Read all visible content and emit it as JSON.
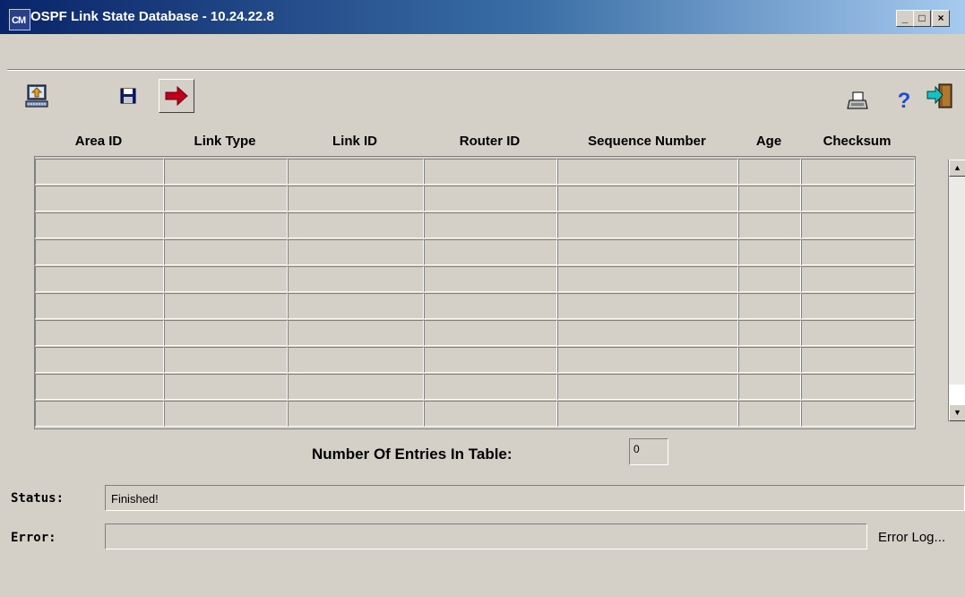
{
  "window": {
    "title": "OSPF Link State Database - 10.24.22.8",
    "app_icon_text": "CM",
    "minimize_label": "_",
    "maximize_label": "□",
    "close_label": "×"
  },
  "toolbar": {
    "left_icons": [
      "load-icon",
      "save-icon",
      "go-arrow-icon"
    ],
    "right_icons": [
      "print-icon",
      "help-icon",
      "exit-icon"
    ],
    "help_glyph": "?"
  },
  "table": {
    "columns": [
      "Area ID",
      "Link Type",
      "Link ID",
      "Router ID",
      "Sequence Number",
      "Age",
      "Checksum"
    ],
    "rows": []
  },
  "footer": {
    "entries_label": "Number Of Entries In Table:",
    "entries_value": "0",
    "status_label": "Status:",
    "status_value": "Finished!",
    "error_label": "Error:",
    "error_value": "",
    "error_log_label": "Error Log..."
  },
  "colors": {
    "background": "#d4d0c8",
    "titlebar_start": "#0a246a",
    "titlebar_end": "#a6caf0",
    "arrow_red": "#c0001a"
  }
}
